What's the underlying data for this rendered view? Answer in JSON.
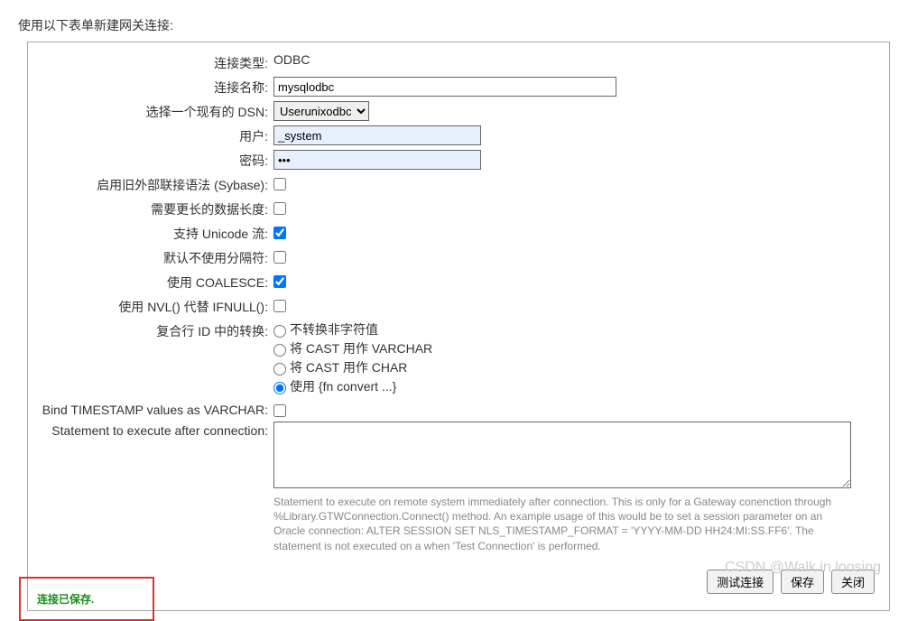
{
  "header": "使用以下表单新建网关连接:",
  "labels": {
    "connType": "连接类型:",
    "connName": "连接名称:",
    "selectDSN": "选择一个现有的 DSN:",
    "user": "用户:",
    "password": "密码:",
    "sybase": "启用旧外部联接语法 (Sybase):",
    "longerData": "需要更长的数据长度:",
    "unicode": "支持 Unicode 流:",
    "noSeparator": "默认不使用分隔符:",
    "coalesce": "使用 COALESCE:",
    "nvl": "使用 NVL() 代替 IFNULL():",
    "compositeId": "复合行 ID 中的转换:",
    "bindTimestamp": "Bind TIMESTAMP values as VARCHAR:",
    "statement": "Statement to execute after connection:"
  },
  "values": {
    "connType": "ODBC",
    "connName": "mysqlodbc",
    "dsn": "Userunixodbc",
    "user": "_system",
    "password": "•••",
    "statement": ""
  },
  "radios": {
    "r1": "不转换非字符值",
    "r2": "将 CAST 用作 VARCHAR",
    "r3": "将 CAST 用作 CHAR",
    "r4": "使用 {fn convert ...}"
  },
  "helpText": "Statement to execute on remote system immediately after connection. This is only for a Gateway conenction through %Library.GTWConnection.Connect() method. An example usage of this would be to set a session parameter on an Oracle connection: ALTER SESSION SET NLS_TIMESTAMP_FORMAT = 'YYYY-MM-DD HH24:MI:SS.FF6'. The statement is not executed on a when 'Test Connection' is performed.",
  "buttons": {
    "test": "测试连接",
    "save": "保存",
    "close": "关闭"
  },
  "savedMessage": "连接已保存.",
  "watermark": "CSDN @Walk in loosing"
}
